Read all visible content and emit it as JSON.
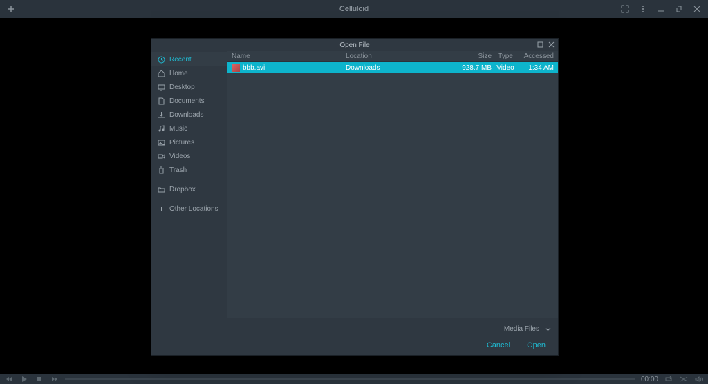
{
  "app": {
    "title": "Celluloid"
  },
  "player": {
    "time": "00:00"
  },
  "dialog": {
    "title": "Open File",
    "sidebar": [
      {
        "label": "Recent",
        "icon": "clock",
        "active": true
      },
      {
        "label": "Home",
        "icon": "home"
      },
      {
        "label": "Desktop",
        "icon": "desktop"
      },
      {
        "label": "Documents",
        "icon": "document"
      },
      {
        "label": "Downloads",
        "icon": "download"
      },
      {
        "label": "Music",
        "icon": "music"
      },
      {
        "label": "Pictures",
        "icon": "picture"
      },
      {
        "label": "Videos",
        "icon": "video"
      },
      {
        "label": "Trash",
        "icon": "trash"
      }
    ],
    "sidebar_extra": [
      {
        "label": "Dropbox",
        "icon": "folder"
      }
    ],
    "sidebar_bottom": [
      {
        "label": "Other Locations",
        "icon": "plus"
      }
    ],
    "columns": {
      "name": "Name",
      "location": "Location",
      "size": "Size",
      "type": "Type",
      "accessed": "Accessed"
    },
    "files": [
      {
        "name": "bbb.avi",
        "location": "Downloads",
        "size": "928.7 MB",
        "type": "Video",
        "accessed": "1:34 AM",
        "selected": true
      }
    ],
    "filter": "Media Files",
    "cancel": "Cancel",
    "open": "Open"
  }
}
